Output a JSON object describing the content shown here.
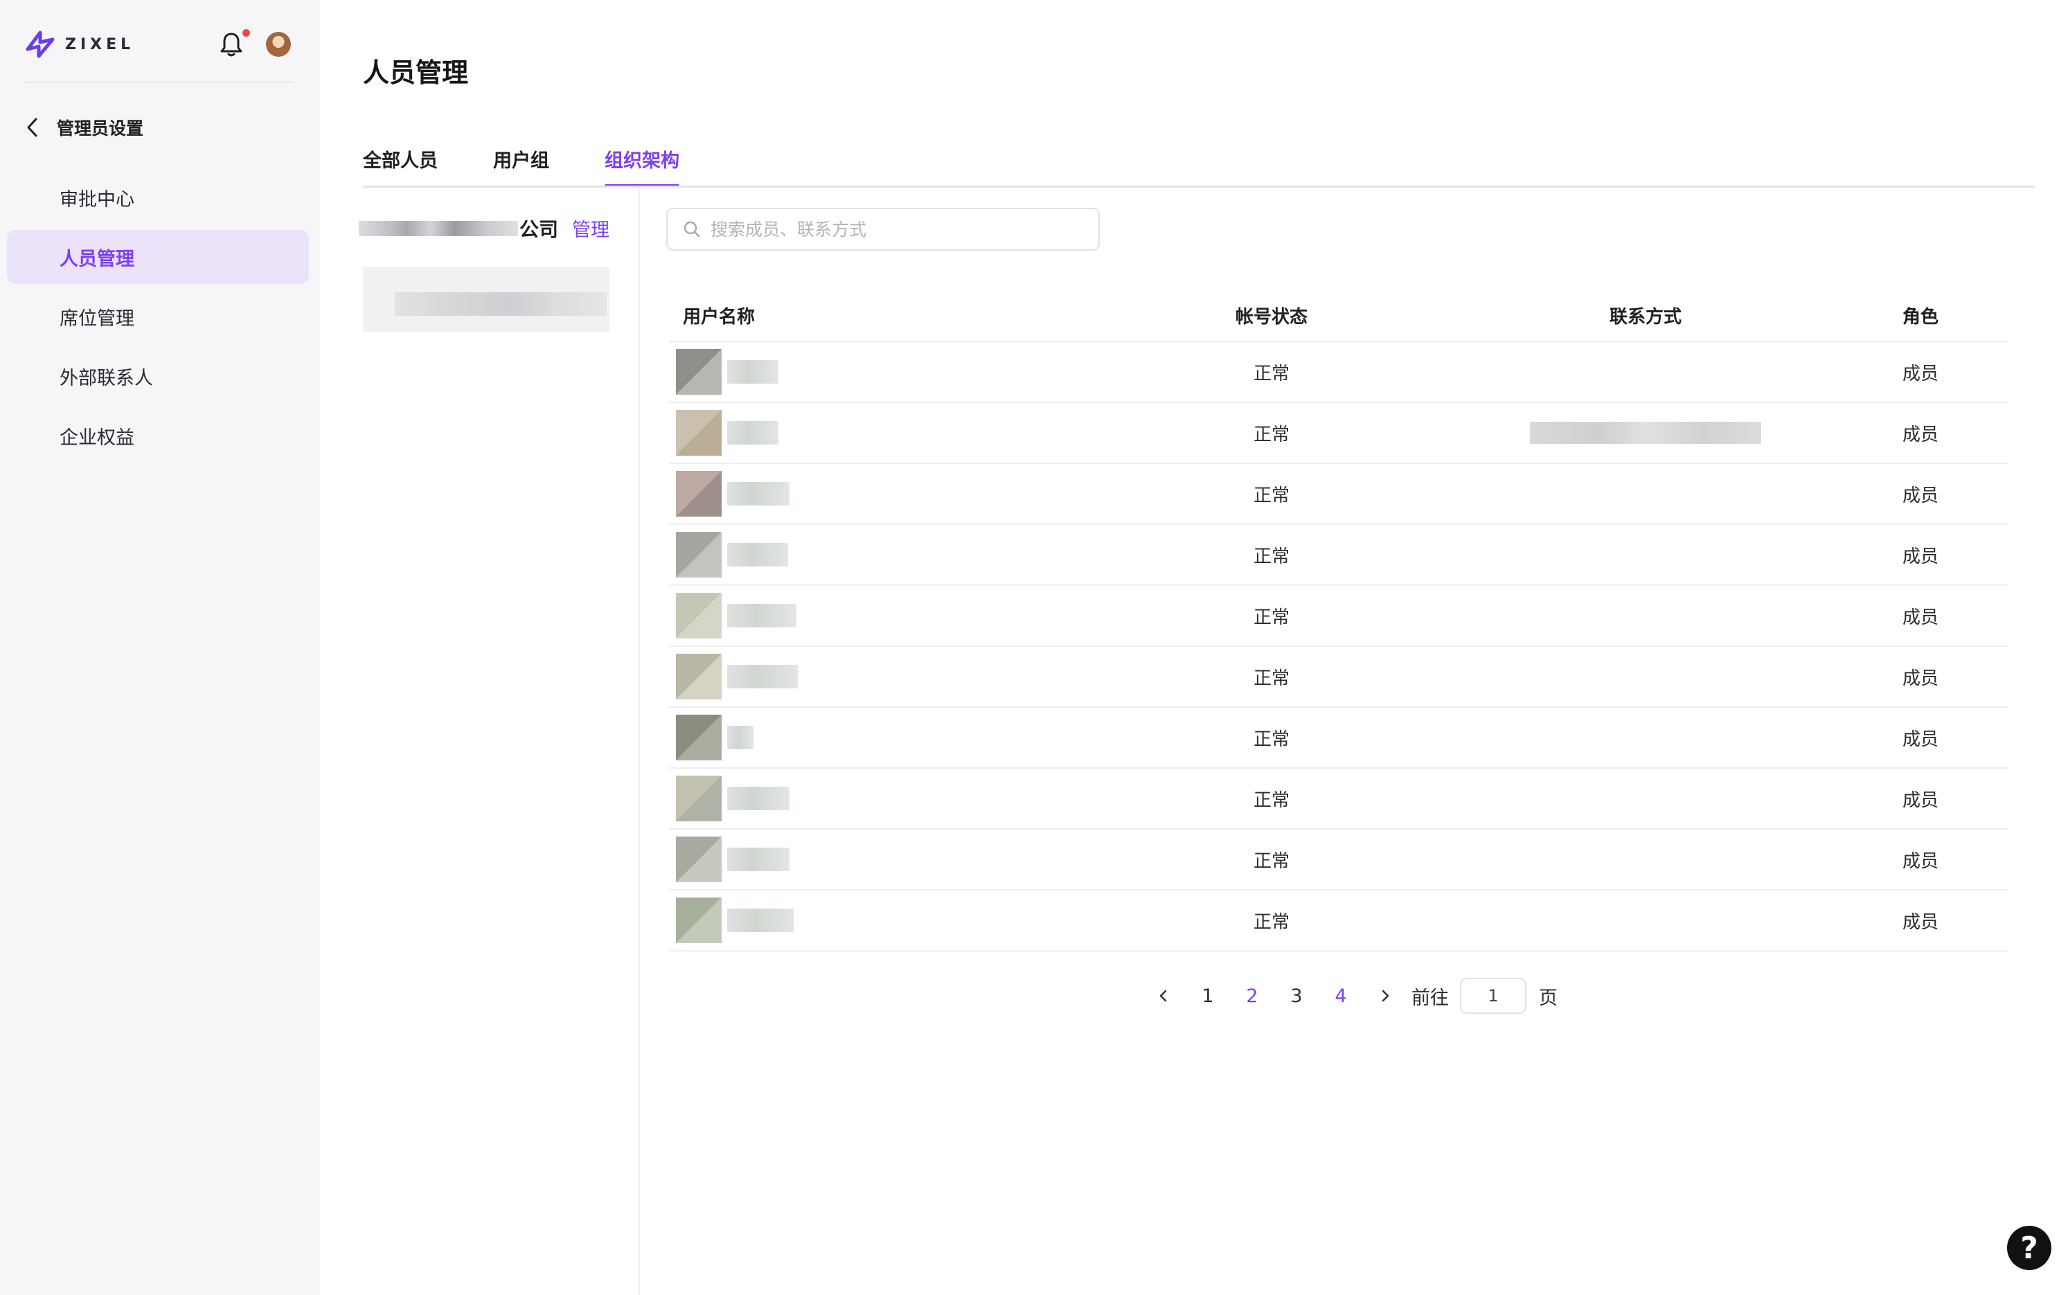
{
  "brand": {
    "name": "ZIXEL",
    "accent": "#7b3ff2"
  },
  "sidebar": {
    "back_label": "管理员设置",
    "items": [
      {
        "label": "审批中心",
        "active": false
      },
      {
        "label": "人员管理",
        "active": true
      },
      {
        "label": "席位管理",
        "active": false
      },
      {
        "label": "外部联系人",
        "active": false
      },
      {
        "label": "企业权益",
        "active": false
      }
    ]
  },
  "page": {
    "title": "人员管理"
  },
  "tabs": [
    {
      "label": "全部人员",
      "active": false
    },
    {
      "label": "用户组",
      "active": false
    },
    {
      "label": "组织架构",
      "active": true
    }
  ],
  "org": {
    "name_suffix": "公司",
    "manage_label": "管理"
  },
  "search": {
    "placeholder": "搜索成员、联系方式",
    "value": ""
  },
  "table": {
    "headers": {
      "name": "用户名称",
      "status": "帐号状态",
      "contact": "联系方式",
      "role": "角色"
    },
    "rows": [
      {
        "status": "正常",
        "role": "成员",
        "contact": ""
      },
      {
        "status": "正常",
        "role": "成员",
        "contact": "(blurred)"
      },
      {
        "status": "正常",
        "role": "成员",
        "contact": ""
      },
      {
        "status": "正常",
        "role": "成员",
        "contact": ""
      },
      {
        "status": "正常",
        "role": "成员",
        "contact": ""
      },
      {
        "status": "正常",
        "role": "成员",
        "contact": ""
      },
      {
        "status": "正常",
        "role": "成员",
        "contact": ""
      },
      {
        "status": "正常",
        "role": "成员",
        "contact": ""
      },
      {
        "status": "正常",
        "role": "成员",
        "contact": ""
      },
      {
        "status": "正常",
        "role": "成员",
        "contact": ""
      }
    ]
  },
  "pagination": {
    "pages": [
      "1",
      "2",
      "3",
      "4"
    ],
    "current": "2",
    "goto_label": "前往",
    "goto_value": "1",
    "goto_suffix": "页"
  },
  "help": {
    "label": "?"
  }
}
